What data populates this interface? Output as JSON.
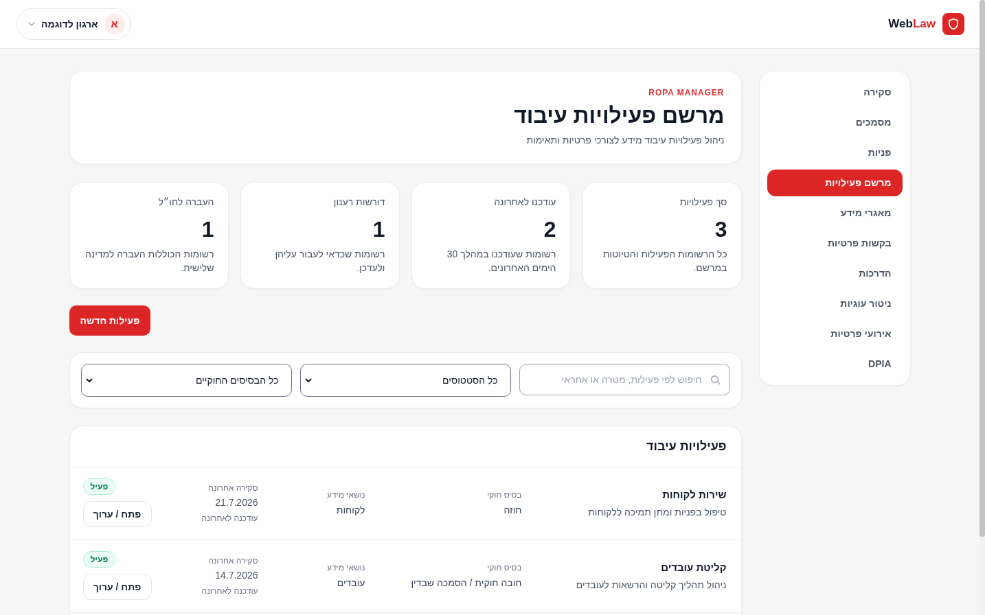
{
  "header": {
    "brand": {
      "text": "Web",
      "accent_text": "Law"
    },
    "org_selector": {
      "avatar": "א",
      "label": "ארגון לדוגמה"
    }
  },
  "sidebar": {
    "items": [
      {
        "label": "סקירה",
        "selected": false
      },
      {
        "label": "מסמכים",
        "selected": false
      },
      {
        "label": "פניות",
        "selected": false
      },
      {
        "label": "מרשם פעילויות",
        "selected": true
      },
      {
        "label": "מאגרי מידע",
        "selected": false
      },
      {
        "label": "בקשות פרטיות",
        "selected": false
      },
      {
        "label": "הדרכות",
        "selected": false
      },
      {
        "label": "ניטור עוגיות",
        "selected": false
      },
      {
        "label": "אירועי פרטיות",
        "selected": false
      },
      {
        "label": "DPIA",
        "selected": false
      }
    ]
  },
  "page_header": {
    "eyebrow": "ROPA MANAGER",
    "title": "מרשם פעילויות עיבוד",
    "subtitle": "ניהול פעילויות עיבוד מידע לצורכי פרטיות ותאימות"
  },
  "stats": [
    {
      "label": "סך פעילויות",
      "value": "3",
      "description": "כל הרשומות הפעילות והטיוטות במרשם."
    },
    {
      "label": "עודכנו לאחרונה",
      "value": "2",
      "description": "רשומות שעודכנו במהלך 30 הימים האחרונים."
    },
    {
      "label": "דורשות רענון",
      "value": "1",
      "description": "רשומות שכדאי לעבור עליהן ולעדכן."
    },
    {
      "label": "העברה לחו״ל",
      "value": "1",
      "description": "רשומות הכוללות העברה למדינה שלישית."
    }
  ],
  "new_activity_button": "פעילות חדשה",
  "filters": {
    "search": {
      "placeholder": "חיפוש לפי פעילות, מטרה או אחראי"
    },
    "status_select": {
      "value": "כל הסטטוסים"
    },
    "basis_select": {
      "value": "כל הבסיסים החוקיים"
    }
  },
  "table": {
    "title": "פעילויות עיבוד",
    "rows": [
      {
        "name": "שירות לקוחות",
        "description": "טיפול בפניות ומתן תמיכה ללקוחות",
        "legal_basis_label": "בסיס חוקי",
        "legal_basis": "חוזה",
        "subjects_label": "נושאי מידע",
        "subjects": "לקוחות",
        "review_label": "סקירה אחרונה",
        "review_date": "21.7.2026",
        "updated_note": "עודכנה לאחרונה",
        "status": "פעיל",
        "action": "פתח / ערוך"
      },
      {
        "name": "קליטת עובדים",
        "description": "ניהול תהליך קליטה והרשאות לעובדים",
        "legal_basis_label": "בסיס חוקי",
        "legal_basis": "חובה חוקית / הסמכה שבדין",
        "subjects_label": "נושאי מידע",
        "subjects": "עובדים",
        "review_label": "סקירה אחרונה",
        "review_date": "14.7.2026",
        "updated_note": "עודכנה לאחרונה",
        "status": "פעיל",
        "action": "פתח / ערוך"
      }
    ]
  }
}
